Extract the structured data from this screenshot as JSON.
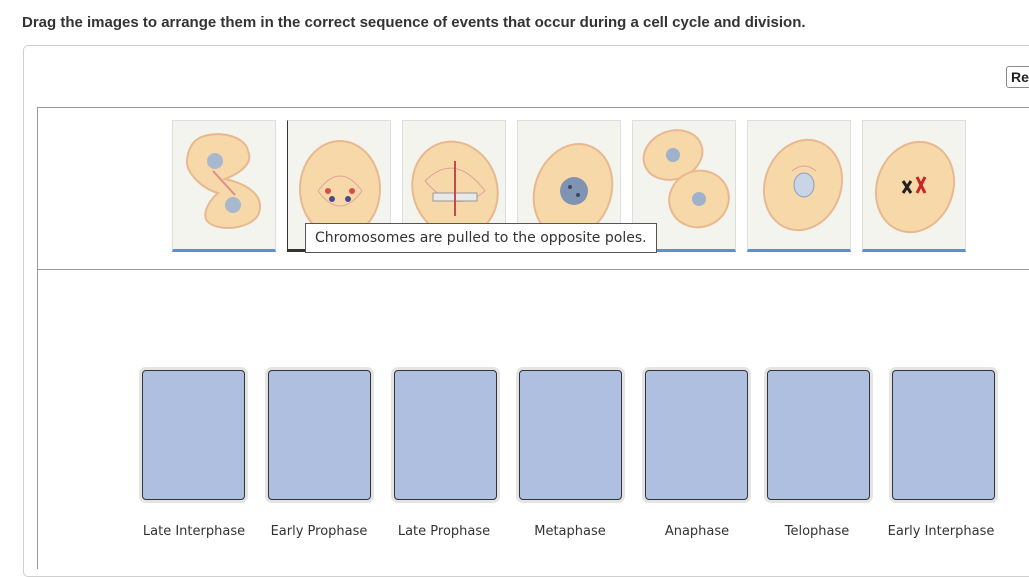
{
  "question": "Drag the images to arrange them in the correct sequence of events that occur during a cell cycle and division.",
  "reset_label": "Re",
  "tooltip": "Chromosomes are pulled to the opposite poles.",
  "source_tiles": [
    {
      "stage_icon": "telophase-cell-icon"
    },
    {
      "stage_icon": "anaphase-cell-icon"
    },
    {
      "stage_icon": "metaphase-cell-icon"
    },
    {
      "stage_icon": "early-prophase-cell-icon"
    },
    {
      "stage_icon": "divided-cells-icon"
    },
    {
      "stage_icon": "late-interphase-cell-icon"
    },
    {
      "stage_icon": "late-prophase-cell-icon"
    }
  ],
  "target_labels": [
    "Late Interphase",
    "Early Prophase",
    "Late Prophase",
    "Metaphase",
    "Anaphase",
    "Telophase",
    "Early Interphase"
  ],
  "colors": {
    "tile_border": "#5b8fd8",
    "slot_fill": "#afbfe0",
    "cell_fill": "#f7d8a8",
    "cell_outline": "#e8b890",
    "nucleus": "#7f93b3"
  }
}
